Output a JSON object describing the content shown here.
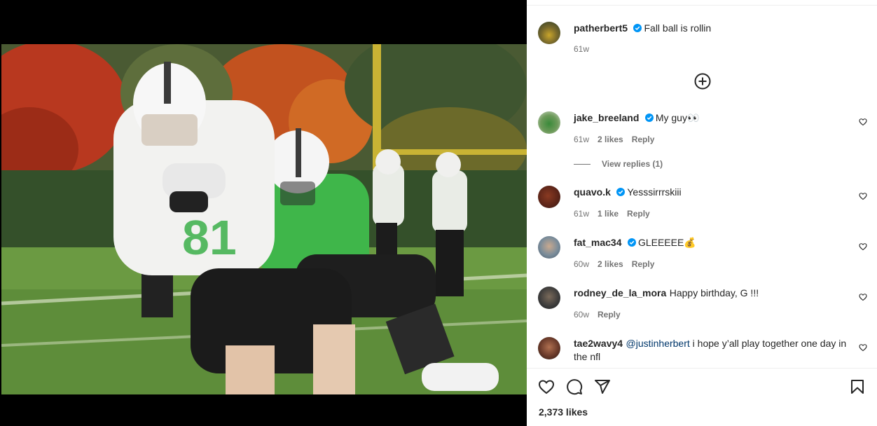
{
  "post": {
    "author": "patherbert5",
    "caption": "Fall ball is rollin",
    "age": "61w",
    "likes": "2,373 likes"
  },
  "comments": [
    {
      "username": "jake_breeland",
      "verified": true,
      "text": "My guy👀",
      "age": "61w",
      "likes": "2 likes",
      "reply": "Reply",
      "view_replies": "View replies (1)"
    },
    {
      "username": "quavo.k",
      "verified": true,
      "text": "Yesssirrrskiii",
      "age": "61w",
      "likes": "1 like",
      "reply": "Reply"
    },
    {
      "username": "fat_mac34",
      "verified": true,
      "text": "GLEEEEE💰",
      "age": "60w",
      "likes": "2 likes",
      "reply": "Reply"
    },
    {
      "username": "rodney_de_la_mora",
      "verified": false,
      "text": "Happy birthday, G !!!",
      "age": "60w",
      "reply": "Reply"
    },
    {
      "username": "tae2wavy4",
      "verified": false,
      "mention": "@justinherbert",
      "text": " i hope y’all play together one day in the nfl"
    }
  ],
  "icons": {
    "verified": "verified-badge-icon",
    "add": "add-circle-icon",
    "like": "heart-icon",
    "comment": "comment-icon",
    "share": "share-icon",
    "save": "bookmark-icon"
  },
  "colors": {
    "verified": "#0095f6",
    "text": "#262626",
    "secondary": "#737373"
  }
}
